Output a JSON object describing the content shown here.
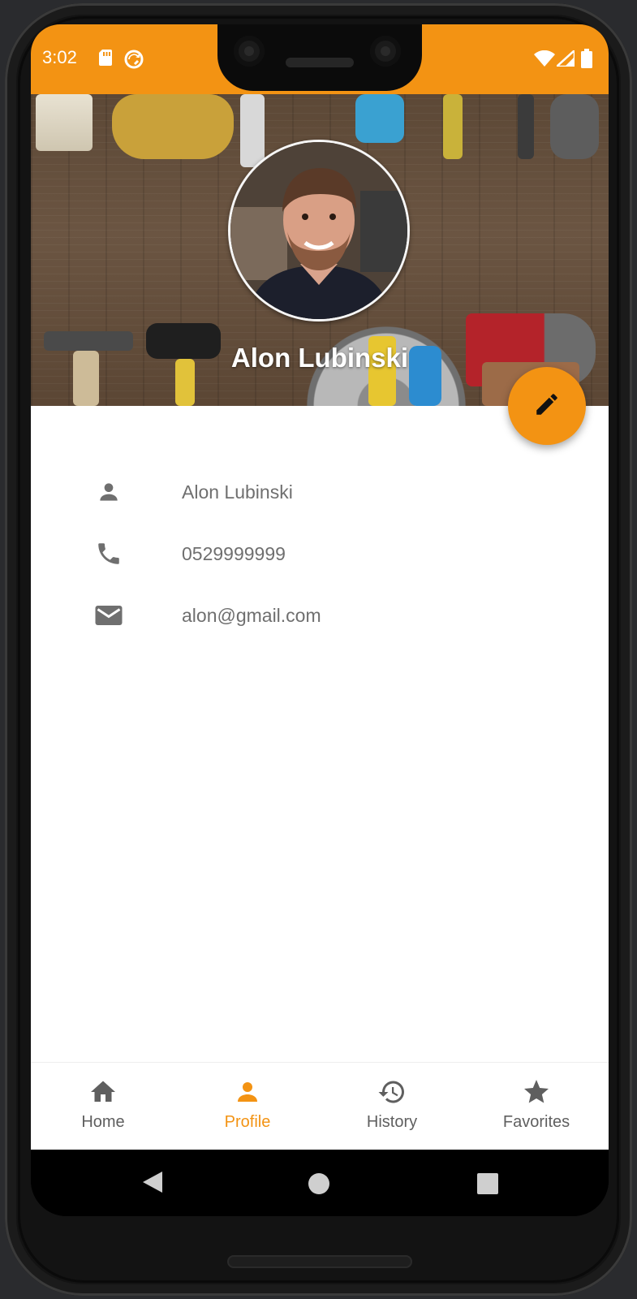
{
  "status_bar": {
    "time": "3:02",
    "color": "#f39313",
    "left_icons": [
      "sd-card-icon",
      "sync-icon"
    ],
    "right_icons": [
      "wifi-icon",
      "cell-signal-icon",
      "battery-icon"
    ]
  },
  "profile": {
    "display_name": "Alon Lubinski",
    "header_background": "tools-on-wood-image",
    "avatar": "profile-photo"
  },
  "details": [
    {
      "icon": "person-icon",
      "value": "Alon Lubinski"
    },
    {
      "icon": "phone-icon",
      "value": "0529999999"
    },
    {
      "icon": "email-icon",
      "value": "alon@gmail.com"
    }
  ],
  "fab": {
    "icon": "pencil-icon",
    "color": "#f39313"
  },
  "bottom_nav": {
    "items": [
      {
        "label": "Home",
        "icon": "home-icon",
        "active": false
      },
      {
        "label": "Profile",
        "icon": "person-icon",
        "active": true
      },
      {
        "label": "History",
        "icon": "history-icon",
        "active": false
      },
      {
        "label": "Favorites",
        "icon": "star-icon",
        "active": false
      }
    ],
    "active_color": "#f39313",
    "inactive_color": "#5f5f5f"
  },
  "system_nav": [
    "back-icon",
    "home-circle-icon",
    "recents-icon"
  ]
}
